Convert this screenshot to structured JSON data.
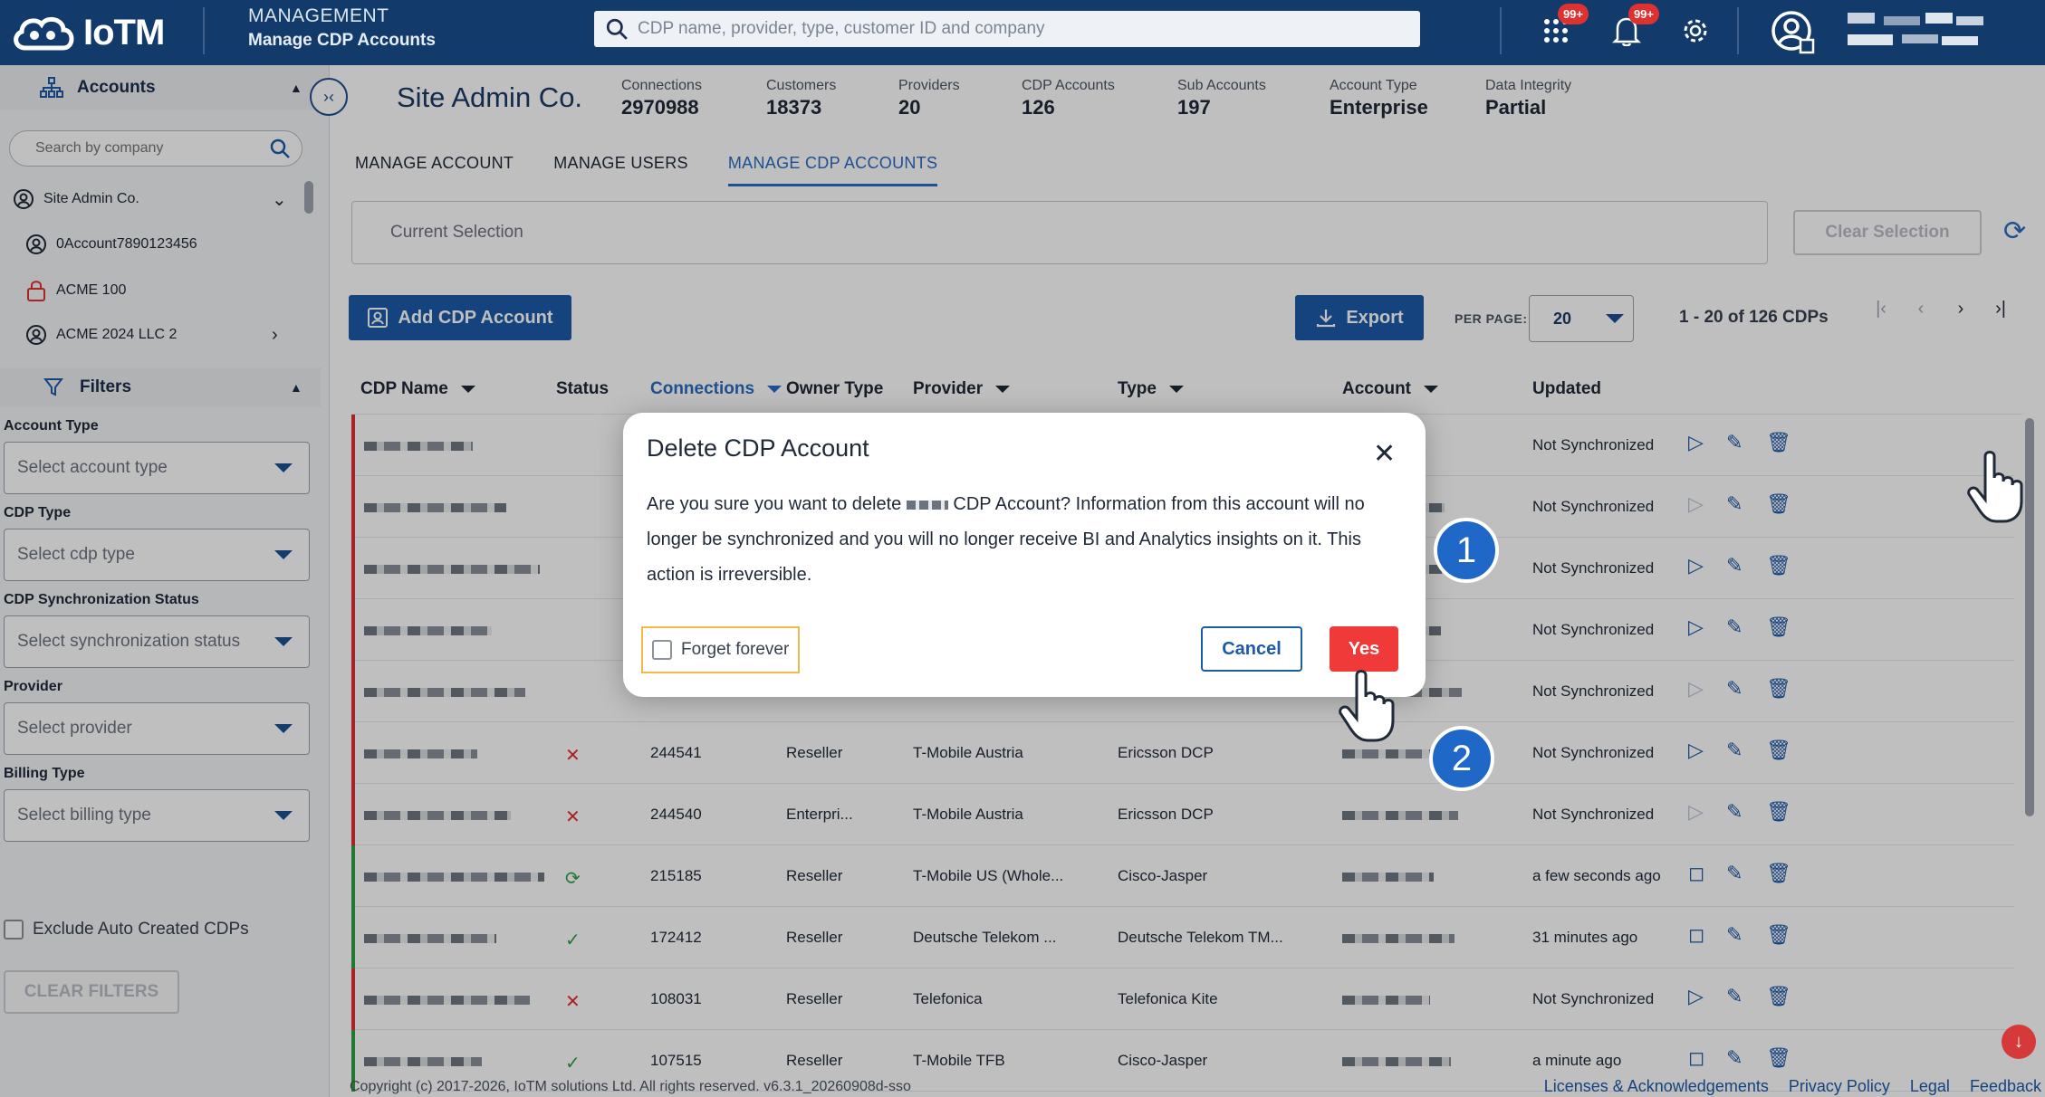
{
  "header": {
    "logo_text": "IoTM",
    "section": "MANAGEMENT",
    "page": "Manage CDP Accounts",
    "search_placeholder": "CDP name, provider, type, customer ID and company",
    "apps_badge": "99+",
    "notifications_badge": "99+"
  },
  "sidebar": {
    "accounts_title": "Accounts",
    "search_placeholder": "Search by company",
    "tree": [
      {
        "label": "Site Admin Co.",
        "icon": "user-circle-icon"
      },
      {
        "label": "0Account7890123456",
        "icon": "user-circle-icon"
      },
      {
        "label": "ACME 100",
        "icon": "lock-icon"
      },
      {
        "label": "ACME 2024 LLC 2",
        "icon": "user-circle-icon"
      }
    ],
    "filters_title": "Filters",
    "filters": [
      {
        "label": "Account Type",
        "placeholder": "Select account type"
      },
      {
        "label": "CDP Type",
        "placeholder": "Select cdp type"
      },
      {
        "label": "CDP Synchronization Status",
        "placeholder": "Select synchronization status"
      },
      {
        "label": "Provider",
        "placeholder": "Select provider"
      },
      {
        "label": "Billing Type",
        "placeholder": "Select billing type"
      }
    ],
    "exclude_label": "Exclude Auto Created CDPs",
    "clear_filters": "CLEAR FILTERS"
  },
  "main": {
    "company": "Site Admin Co.",
    "stats": [
      {
        "label": "Connections",
        "value": "2970988"
      },
      {
        "label": "Customers",
        "value": "18373"
      },
      {
        "label": "Providers",
        "value": "20"
      },
      {
        "label": "CDP Accounts",
        "value": "126"
      },
      {
        "label": "Sub Accounts",
        "value": "197"
      },
      {
        "label": "Account Type",
        "value": "Enterprise"
      },
      {
        "label": "Data Integrity",
        "value": "Partial"
      }
    ],
    "tabs": [
      "MANAGE ACCOUNT",
      "MANAGE USERS",
      "MANAGE CDP ACCOUNTS"
    ],
    "active_tab": "MANAGE CDP ACCOUNTS",
    "current_selection": "Current Selection",
    "clear_selection": "Clear Selection",
    "add_button": "Add CDP Account",
    "export_button": "Export",
    "per_page_label": "PER PAGE:",
    "per_page_value": "20",
    "range": "1 - 20 of 126 CDPs",
    "columns": [
      "CDP Name",
      "Status",
      "Connections",
      "Owner Type",
      "Provider",
      "Type",
      "Account",
      "Updated"
    ],
    "rows": [
      {
        "status": "",
        "connections": "",
        "owner": "",
        "provider": "",
        "type": "",
        "updated": "Not Synchronized",
        "bar": "#e03131",
        "play_enabled": true
      },
      {
        "status": "",
        "connections": "",
        "owner": "",
        "provider": "",
        "type": "",
        "updated": "Not Synchronized",
        "bar": "#e03131",
        "play_enabled": false
      },
      {
        "status": "",
        "connections": "",
        "owner": "",
        "provider": "",
        "type": "",
        "updated": "Not Synchronized",
        "bar": "#e03131",
        "play_enabled": true
      },
      {
        "status": "",
        "connections": "",
        "owner": "",
        "provider": "",
        "type": "",
        "updated": "Not Synchronized",
        "bar": "#e03131",
        "play_enabled": true
      },
      {
        "status": "",
        "connections": "",
        "owner": "",
        "provider": "",
        "type": "",
        "updated": "Not Synchronized",
        "bar": "#e03131",
        "play_enabled": false
      },
      {
        "status": "x",
        "connections": "244541",
        "owner": "Reseller",
        "provider": "T-Mobile Austria",
        "type": "Ericsson DCP",
        "updated": "Not Synchronized",
        "bar": "#e03131",
        "play_enabled": true
      },
      {
        "status": "x",
        "connections": "244540",
        "owner": "Enterpri...",
        "provider": "T-Mobile Austria",
        "type": "Ericsson DCP",
        "updated": "Not Synchronized",
        "bar": "#e03131",
        "play_enabled": false
      },
      {
        "status": "sync",
        "connections": "215185",
        "owner": "Reseller",
        "provider": "T-Mobile US (Whole...",
        "type": "Cisco-Jasper",
        "updated": "a few seconds ago",
        "bar": "#2f9e44",
        "play_enabled": true
      },
      {
        "status": "ok",
        "connections": "172412",
        "owner": "Reseller",
        "provider": "Deutsche Telekom ...",
        "type": "Deutsche Telekom TM...",
        "updated": "31 minutes ago",
        "bar": "#2f9e44",
        "play_enabled": true
      },
      {
        "status": "x",
        "connections": "108031",
        "owner": "Reseller",
        "provider": "Telefonica",
        "type": "Telefonica Kite",
        "updated": "Not Synchronized",
        "bar": "#e03131",
        "play_enabled": true
      },
      {
        "status": "ok",
        "connections": "107515",
        "owner": "Reseller",
        "provider": "T-Mobile TFB",
        "type": "Cisco-Jasper",
        "updated": "a minute ago",
        "bar": "#2f9e44",
        "play_enabled": true
      }
    ]
  },
  "modal": {
    "title": "Delete CDP Account",
    "body_pre": "Are you sure you want to delete",
    "body_post": "CDP Account? Information from this account will no longer be synchronized and you will no longer receive BI and Analytics insights on it. This action is irreversible.",
    "forget_label": "Forget forever",
    "cancel": "Cancel",
    "yes": "Yes"
  },
  "steps": [
    "1",
    "2"
  ],
  "footer": {
    "copyright": "Copyright (c) 2017-2026, IoTM solutions Ltd. All rights reserved. v6.3.1_20260908d-sso",
    "links": [
      "Licenses & Acknowledgements",
      "Privacy Policy",
      "Legal",
      "Feedback"
    ]
  },
  "colors": {
    "primary": "#1d5aa8",
    "header": "#123a6b",
    "danger": "#f03a3a",
    "ok": "#2f9e44",
    "step": "#1f68c7"
  }
}
